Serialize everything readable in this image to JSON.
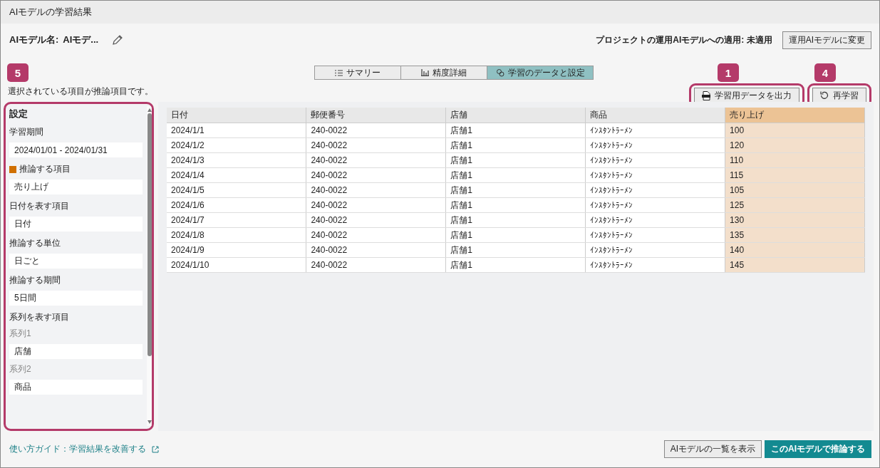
{
  "window": {
    "title": "AIモデルの学習結果"
  },
  "model": {
    "label": "AIモデル名:",
    "name": "AIモデ..."
  },
  "apply": {
    "status": "プロジェクトの運用AIモデルへの適用: 未適用",
    "button": "運用AIモデルに変更"
  },
  "tabs": [
    {
      "label": "サマリー",
      "selected": false
    },
    {
      "label": "精度詳細",
      "selected": false
    },
    {
      "label": "学習のデータと設定",
      "selected": true
    }
  ],
  "hint": "選択されている項目が推論項目です。",
  "actions": [
    {
      "label": "学習用データを出力",
      "callout": "1"
    },
    {
      "label": "再学習",
      "callout": "4"
    }
  ],
  "settings": {
    "title": "設定",
    "callout": "5",
    "fields": [
      {
        "kind": "field",
        "label": "学習期間",
        "value": "2024/01/01 - 2024/01/31"
      },
      {
        "kind": "field",
        "label": "推論する項目",
        "value": "売り上げ",
        "color": "#d07000"
      },
      {
        "kind": "field",
        "label": "日付を表す項目",
        "value": "日付"
      },
      {
        "kind": "field",
        "label": "推論する単位",
        "value": "日ごと"
      },
      {
        "kind": "field",
        "label": "推論する期間",
        "value": "5日間"
      },
      {
        "kind": "group",
        "label": "系列を表す項目",
        "children": [
          {
            "label": "系列1",
            "value": "店舗"
          },
          {
            "label": "系列2",
            "value": "商品"
          }
        ]
      }
    ]
  },
  "table": {
    "columns": [
      {
        "label": "日付",
        "target": false
      },
      {
        "label": "郵便番号",
        "target": false
      },
      {
        "label": "店舗",
        "target": false
      },
      {
        "label": "商品",
        "target": false
      },
      {
        "label": "売り上げ",
        "target": true
      }
    ],
    "rows": [
      [
        "2024/1/1",
        "240-0022",
        "店舗1",
        "ｲﾝｽﾀﾝﾄﾗｰﾒﾝ",
        "100"
      ],
      [
        "2024/1/2",
        "240-0022",
        "店舗1",
        "ｲﾝｽﾀﾝﾄﾗｰﾒﾝ",
        "120"
      ],
      [
        "2024/1/3",
        "240-0022",
        "店舗1",
        "ｲﾝｽﾀﾝﾄﾗｰﾒﾝ",
        "110"
      ],
      [
        "2024/1/4",
        "240-0022",
        "店舗1",
        "ｲﾝｽﾀﾝﾄﾗｰﾒﾝ",
        "115"
      ],
      [
        "2024/1/5",
        "240-0022",
        "店舗1",
        "ｲﾝｽﾀﾝﾄﾗｰﾒﾝ",
        "105"
      ],
      [
        "2024/1/6",
        "240-0022",
        "店舗1",
        "ｲﾝｽﾀﾝﾄﾗｰﾒﾝ",
        "125"
      ],
      [
        "2024/1/7",
        "240-0022",
        "店舗1",
        "ｲﾝｽﾀﾝﾄﾗｰﾒﾝ",
        "130"
      ],
      [
        "2024/1/8",
        "240-0022",
        "店舗1",
        "ｲﾝｽﾀﾝﾄﾗｰﾒﾝ",
        "135"
      ],
      [
        "2024/1/9",
        "240-0022",
        "店舗1",
        "ｲﾝｽﾀﾝﾄﾗｰﾒﾝ",
        "140"
      ],
      [
        "2024/1/10",
        "240-0022",
        "店舗1",
        "ｲﾝｽﾀﾝﾄﾗｰﾒﾝ",
        "145"
      ]
    ]
  },
  "footer": {
    "guide_link": "使い方ガイド：学習結果を改善する",
    "buttons": [
      {
        "label": "AIモデルの一覧を表示",
        "primary": false
      },
      {
        "label": "このAIモデルで推論する",
        "primary": true
      }
    ]
  }
}
